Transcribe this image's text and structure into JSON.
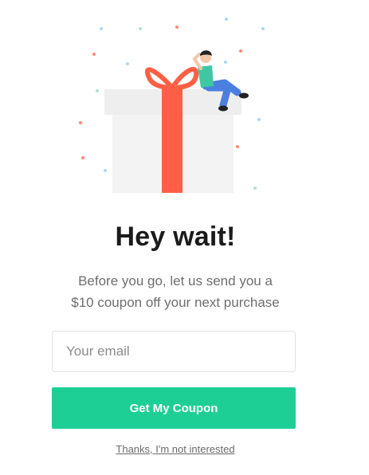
{
  "popup": {
    "title": "Hey wait!",
    "subtitle_line1": "Before you go, let us send you a",
    "subtitle_line2": "$10 coupon off your next purchase",
    "email_placeholder": "Your email",
    "email_value": "",
    "cta_label": "Get My Coupon",
    "decline_label": "Thanks, I'm not interested"
  },
  "colors": {
    "accent": "#1ecf95",
    "ribbon": "#ff6045",
    "box": "#f3f3f3",
    "title": "#1b1b1b",
    "subtitle": "#6e6e6e"
  },
  "icons": {
    "illustration": "gift-box-with-person-illustration"
  }
}
